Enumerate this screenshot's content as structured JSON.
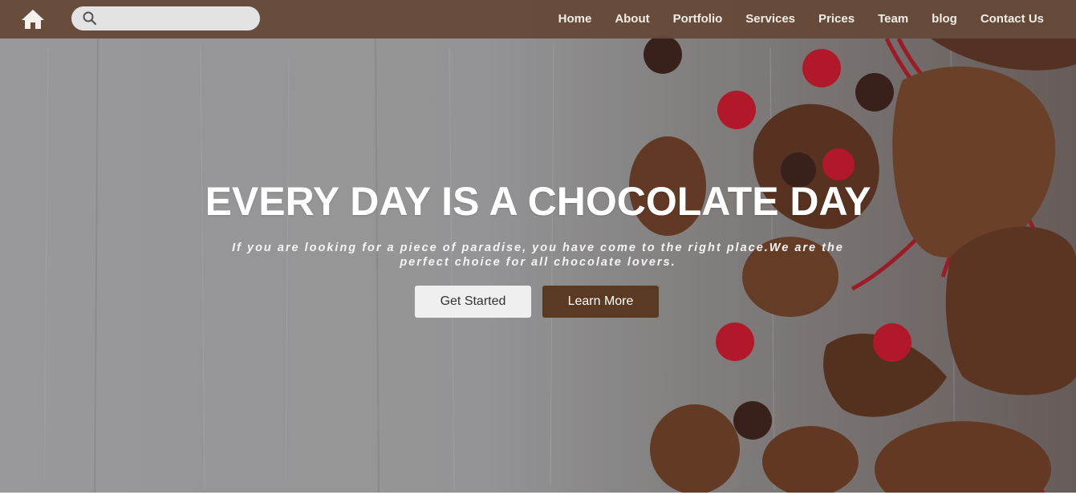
{
  "nav": {
    "home_icon": "home-icon",
    "search_icon": "search-icon",
    "search_placeholder": "",
    "items": [
      {
        "label": "Home"
      },
      {
        "label": "About"
      },
      {
        "label": "Portfolio"
      },
      {
        "label": "Services"
      },
      {
        "label": "Prices"
      },
      {
        "label": "Team"
      },
      {
        "label": "blog"
      },
      {
        "label": "Contact Us"
      }
    ]
  },
  "hero": {
    "title": "EVERY DAY IS A CHOCOLATE DAY",
    "subtitle": "If you are looking for a piece of paradise, you have come to the right place.We are the perfect choice for all chocolate lovers.",
    "primary_button": "Get Started",
    "secondary_button": "Learn More"
  },
  "colors": {
    "navbar": "#654837",
    "secondary_button": "#5a3a22",
    "primary_button": "#efefef",
    "chocolate": "#5b3322",
    "berry": "#c4162a"
  }
}
